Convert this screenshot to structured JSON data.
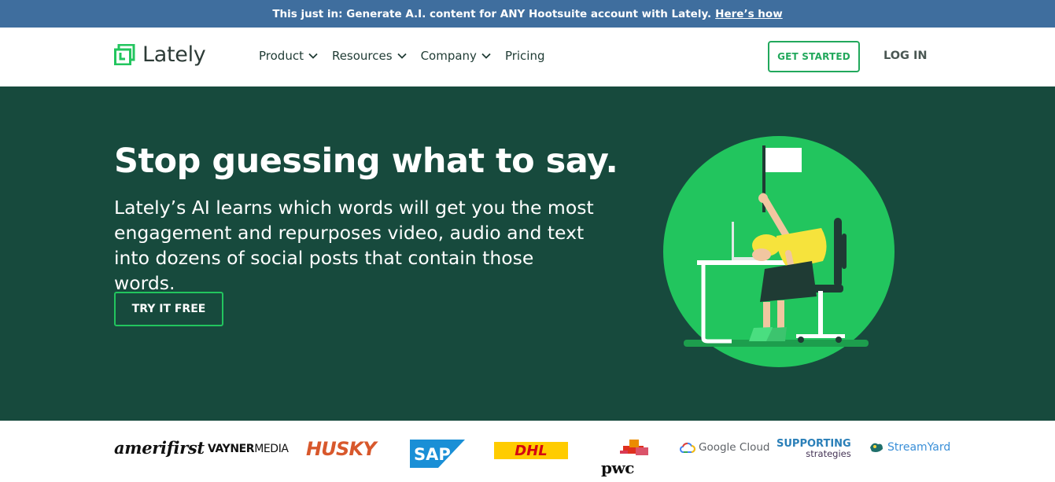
{
  "announcement": {
    "text": "This just in: Generate A.I. content for ANY Hootsuite account with Lately.",
    "link": "Here’s how"
  },
  "nav": {
    "logo_text": "Lately",
    "menu": [
      {
        "label": "Product",
        "has_dropdown": true
      },
      {
        "label": "Resources",
        "has_dropdown": true
      },
      {
        "label": "Company",
        "has_dropdown": true
      },
      {
        "label": "Pricing",
        "has_dropdown": false
      }
    ],
    "get_started": "GET STARTED",
    "login": "LOG IN"
  },
  "hero": {
    "headline": "Stop guessing what to say.",
    "body": "Lately’s AI learns which words will get you the most engagement and repurposes video, audio and text into dozens of social posts that contain those words.",
    "cta": "TRY IT FREE"
  },
  "logos": {
    "amerifirst": "amerifirst",
    "vayner_bold": "VAYNER",
    "vayner_light": "MEDIA",
    "husky": "HUSKY",
    "sap": "SAP",
    "dhl": "DHL",
    "pwc": "pwc",
    "google_cloud": "Google Cloud",
    "supporting_line1": "SUPPORTING",
    "supporting_line2": "strategies",
    "streamyard": "StreamYard"
  },
  "colors": {
    "announcement_bg": "#3f6e9e",
    "hero_bg": "#174a3d",
    "accent_green": "#22c55e",
    "button_outline": "#22a85c"
  }
}
